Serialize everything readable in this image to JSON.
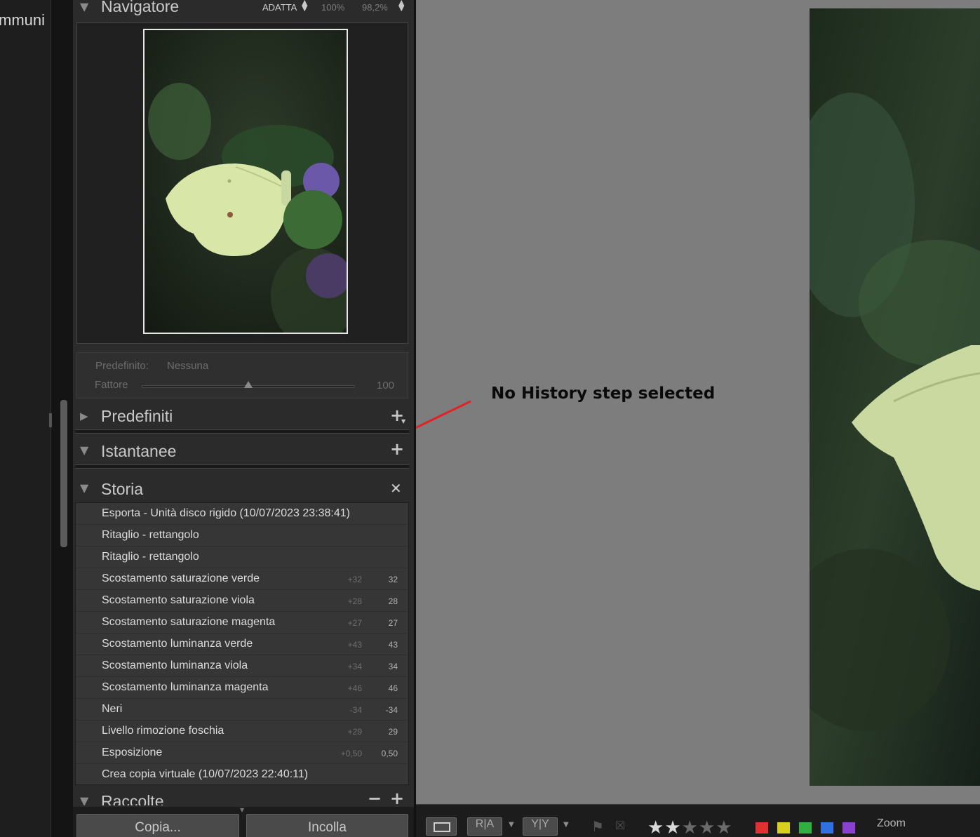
{
  "left_strip": {
    "cut_label": "mmuni"
  },
  "navigator": {
    "title": "Navigatore",
    "zoom_fit": "ADATTA",
    "zoom_100": "100%",
    "zoom_other": "98,2%"
  },
  "quick_develop": {
    "preset_label": "Predefinito:",
    "preset_value": "Nessuna",
    "amount_label": "Fattore",
    "amount_value": "100",
    "amount_level_percent": 50
  },
  "sections": {
    "presets": "Predefiniti",
    "snapshots": "Istantanee",
    "history": "Storia",
    "collections": "Raccolte"
  },
  "history": [
    {
      "name": "Esporta - Unità disco rigido (10/07/2023 23:38:41)",
      "delta": "",
      "value": ""
    },
    {
      "name": "Ritaglio - rettangolo",
      "delta": "",
      "value": ""
    },
    {
      "name": "Ritaglio - rettangolo",
      "delta": "",
      "value": ""
    },
    {
      "name": "Scostamento saturazione verde",
      "delta": "+32",
      "value": "32"
    },
    {
      "name": "Scostamento saturazione viola",
      "delta": "+28",
      "value": "28"
    },
    {
      "name": "Scostamento saturazione magenta",
      "delta": "+27",
      "value": "27"
    },
    {
      "name": "Scostamento luminanza verde",
      "delta": "+43",
      "value": "43"
    },
    {
      "name": "Scostamento luminanza viola",
      "delta": "+34",
      "value": "34"
    },
    {
      "name": "Scostamento luminanza magenta",
      "delta": "+46",
      "value": "46"
    },
    {
      "name": "Neri",
      "delta": "-34",
      "value": "-34"
    },
    {
      "name": "Livello rimozione foschia",
      "delta": "+29",
      "value": "29"
    },
    {
      "name": "Esposizione",
      "delta": "+0,50",
      "value": "0,50"
    },
    {
      "name": "Crea copia virtuale (10/07/2023 22:40:11)",
      "delta": "",
      "value": ""
    }
  ],
  "buttons": {
    "copy": "Copia...",
    "paste": "Incolla"
  },
  "annotation": {
    "text": "No History step selected",
    "arrow_color": "#e02424"
  },
  "toolbar": {
    "ra_label": "R|A",
    "yy_label": "Y|Y",
    "rating": 2,
    "max_rating": 5,
    "color_labels": [
      "#e03030",
      "#d8d020",
      "#30b040",
      "#3070e0",
      "#8a40d0"
    ],
    "zoom_label": "Zoom"
  }
}
